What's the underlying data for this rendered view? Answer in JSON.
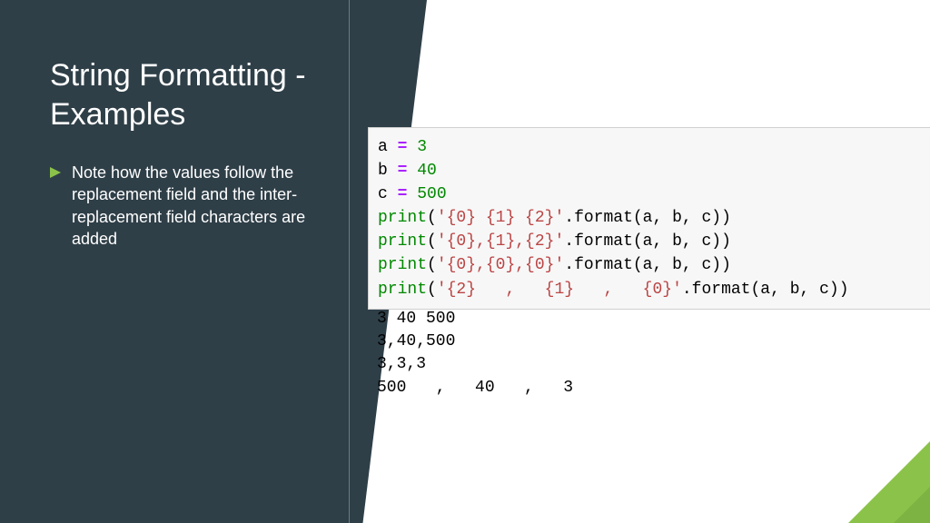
{
  "slide": {
    "title": "String Formatting - Examples",
    "bullet": "Note how the values follow the replacement field and the inter-replacement field characters are added"
  },
  "code": {
    "line1": {
      "var": "a",
      "eq": "=",
      "val": "3"
    },
    "line2": {
      "var": "b",
      "eq": "=",
      "val": "40"
    },
    "line3": {
      "var": "c",
      "eq": "=",
      "val": "500"
    },
    "line4": {
      "func": "print",
      "open": "(",
      "str": "'{0} {1} {2}'",
      "meth": ".format(a, b, c))"
    },
    "line5": {
      "func": "print",
      "open": "(",
      "str": "'{0},{1},{2}'",
      "meth": ".format(a, b, c))"
    },
    "line6": {
      "func": "print",
      "open": "(",
      "str": "'{0},{0},{0}'",
      "meth": ".format(a, b, c))"
    },
    "line7": {
      "func": "print",
      "open": "(",
      "str": "'{2}   ,   {1}   ,   {0}'",
      "meth": ".format(a, b, c))"
    }
  },
  "output": {
    "line1": "3 40 500",
    "line2": "3,40,500",
    "line3": "3,3,3",
    "line4": "500   ,   40   ,   3"
  }
}
